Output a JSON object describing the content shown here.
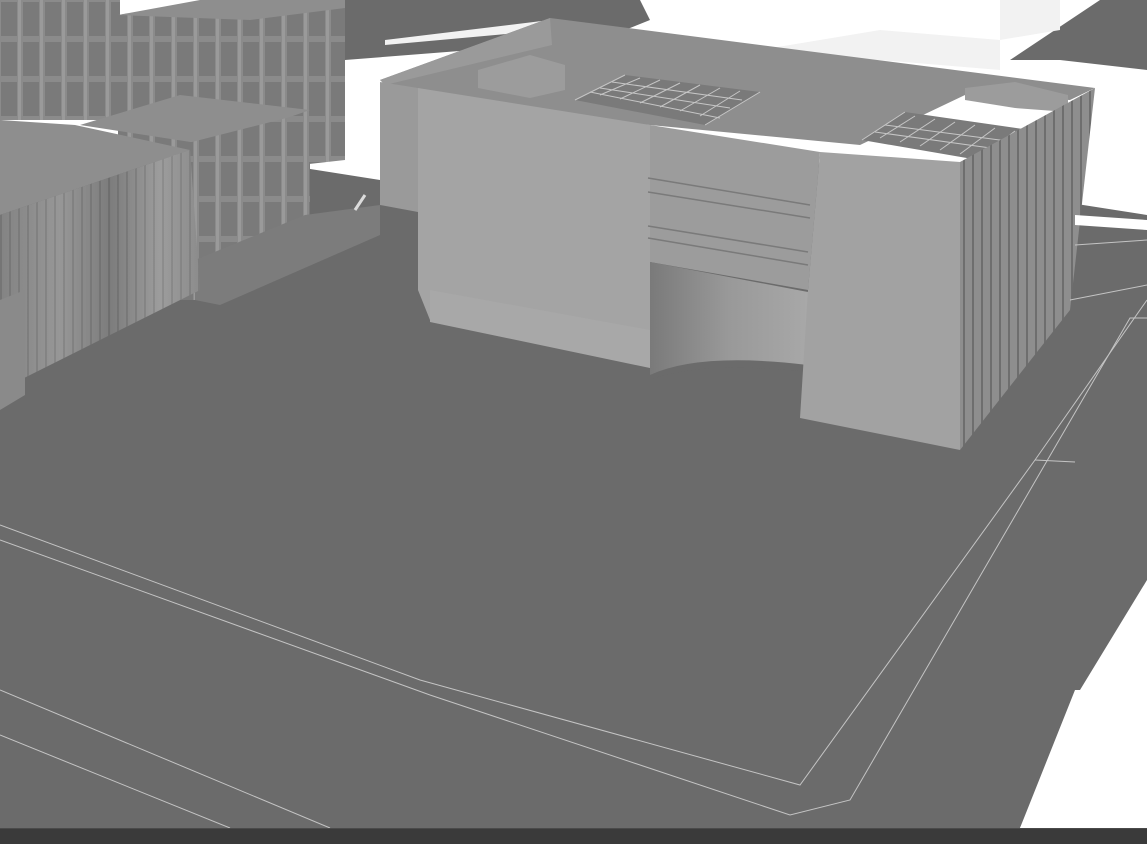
{
  "scene": {
    "description_visible_text": "",
    "colors": {
      "sky_ground_white": "#ffffff",
      "terrain": "#6b6b6b",
      "roof": "#8e8e8e",
      "wall_light": "#a4a4a4",
      "wall_mid": "#969696",
      "wall_dark": "#7c7c7c",
      "line": "#b8b8b8",
      "status_bar": "#3a3a3a"
    }
  },
  "status_bar": {
    "text": ""
  }
}
